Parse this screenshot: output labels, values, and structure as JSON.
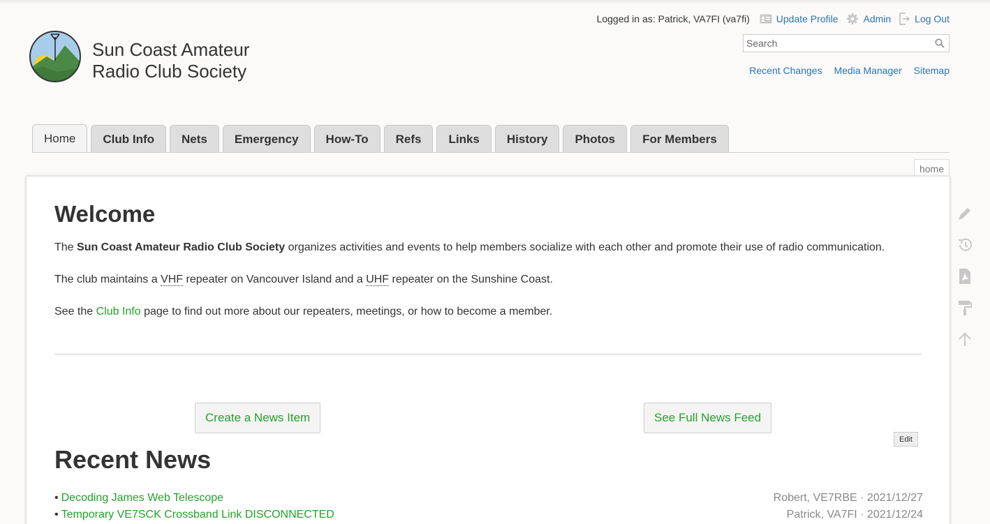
{
  "header": {
    "site_title_line1": "Sun Coast Amateur",
    "site_title_line2": "Radio Club Society",
    "logged_in_text": "Logged in as: Patrick, VA7FI (va7fi)",
    "user_tools": [
      {
        "label": "Update Profile",
        "icon": "profile-card-icon"
      },
      {
        "label": "Admin",
        "icon": "gear-icon"
      },
      {
        "label": "Log Out",
        "icon": "logout-icon"
      }
    ],
    "search": {
      "placeholder": "Search",
      "value": ""
    },
    "site_tools": [
      "Recent Changes",
      "Media Manager",
      "Sitemap"
    ]
  },
  "tabs": [
    {
      "label": "Home",
      "active": true
    },
    {
      "label": "Club Info"
    },
    {
      "label": "Nets"
    },
    {
      "label": "Emergency"
    },
    {
      "label": "How-To"
    },
    {
      "label": "Refs"
    },
    {
      "label": "Links"
    },
    {
      "label": "History"
    },
    {
      "label": "Photos"
    },
    {
      "label": "For Members"
    }
  ],
  "page_id": "home",
  "main": {
    "heading": "Welcome",
    "intro": {
      "before": "The ",
      "bold": "Sun Coast Amateur Radio Club Society",
      "after": " organizes activities and events to help members socialize with each other and promote their use of radio communication."
    },
    "repeaters": {
      "t1": "The club maintains a ",
      "abbr1": "VHF",
      "t2": " repeater on Vancouver Island and a ",
      "abbr2": "UHF",
      "t3": " repeater on the Sunshine Coast."
    },
    "club_info": {
      "before": "See the ",
      "link": "Club Info",
      "after": " page to find out more about our repeaters, meetings, or how to become a member."
    },
    "create_news_button": "Create a News Item",
    "news_feed_button": "See Full News Feed",
    "edit_button": "Edit",
    "news_heading": "Recent News",
    "news_items": [
      {
        "title": "Decoding James Web Telescope",
        "meta": "Robert, VE7RBE · 2021/12/27"
      },
      {
        "title": "Temporary VE7SCK Crossband Link DISCONNECTED",
        "meta": "Patrick, VA7FI · 2021/12/24"
      }
    ]
  },
  "page_tools": [
    "pencil-icon",
    "history-icon",
    "pdf-icon",
    "paint-roller-icon",
    "arrow-up-icon"
  ],
  "colors": {
    "link": "#2b73b7",
    "internal_link": "#22a32a",
    "text": "#333333",
    "background": "#fbfaf9"
  }
}
